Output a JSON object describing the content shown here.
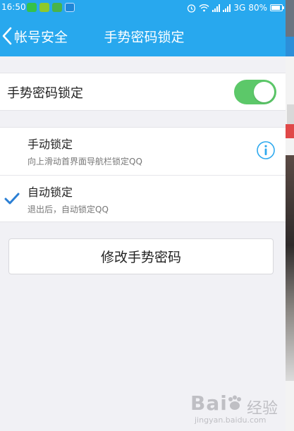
{
  "status_bar": {
    "time": "16:50",
    "network": "3G",
    "battery": "80%"
  },
  "header": {
    "back_label": "帐号安全",
    "title": "手势密码锁定"
  },
  "gesture_lock": {
    "label": "手势密码锁定",
    "enabled": true
  },
  "lock_options": [
    {
      "title": "手动锁定",
      "desc": "向上滑动首界面导航栏锁定QQ",
      "selected": false
    },
    {
      "title": "自动锁定",
      "desc": "退出后，自动锁定QQ",
      "selected": true
    }
  ],
  "change_button": {
    "label": "修改手势密码"
  },
  "watermark": {
    "logo": "Bai",
    "brand": "经验",
    "site": "jingyan.baidu.com"
  },
  "colors": {
    "accent": "#28a8ee",
    "toggle_on": "#5cc869",
    "check": "#2b7fd4"
  }
}
